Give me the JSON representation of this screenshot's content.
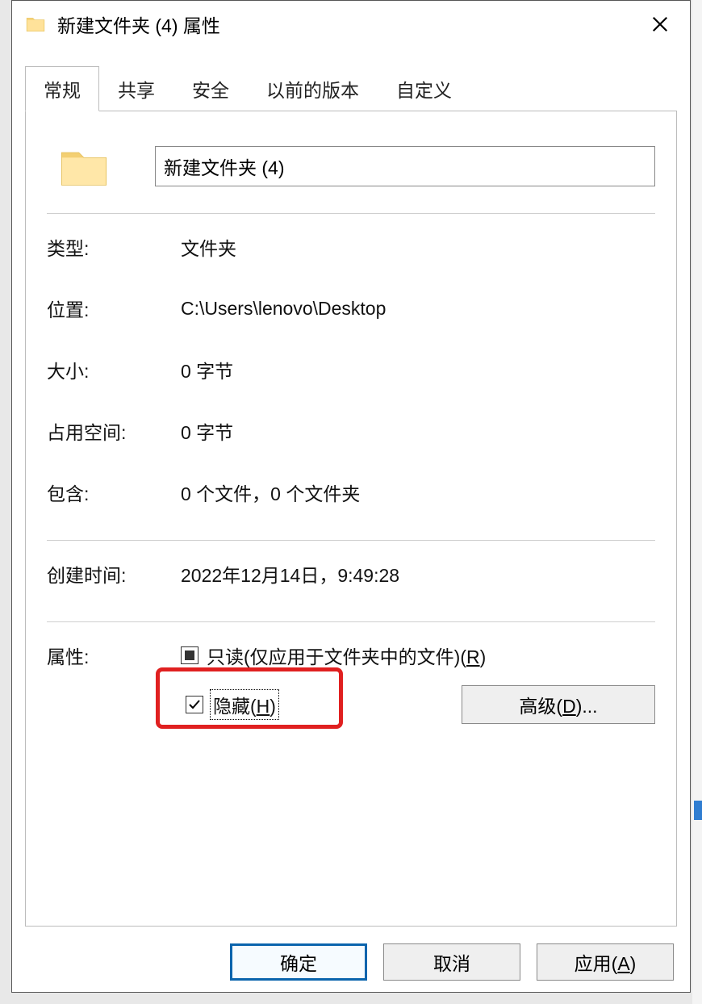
{
  "window": {
    "title": "新建文件夹 (4) 属性"
  },
  "tabs": [
    {
      "label": "常规",
      "active": true
    },
    {
      "label": "共享",
      "active": false
    },
    {
      "label": "安全",
      "active": false
    },
    {
      "label": "以前的版本",
      "active": false
    },
    {
      "label": "自定义",
      "active": false
    }
  ],
  "general": {
    "name_value": "新建文件夹 (4)",
    "type_label": "类型:",
    "type_value": "文件夹",
    "location_label": "位置:",
    "location_value": "C:\\Users\\lenovo\\Desktop",
    "size_label": "大小:",
    "size_value": "0 字节",
    "size_on_disk_label": "占用空间:",
    "size_on_disk_value": "0 字节",
    "contains_label": "包含:",
    "contains_value": "0 个文件，0 个文件夹",
    "created_label": "创建时间:",
    "created_value": "2022年12月14日，9:49:28",
    "attributes_label": "属性:",
    "readonly_label_prefix": "只读(仅应用于文件夹中的文件)(",
    "readonly_hotkey": "R",
    "readonly_label_suffix": ")",
    "readonly_state": "indeterminate",
    "hidden_label_prefix": "隐藏(",
    "hidden_hotkey": "H",
    "hidden_label_suffix": ")",
    "hidden_state": "checked",
    "advanced_label_prefix": "高级(",
    "advanced_hotkey": "D",
    "advanced_label_suffix": ")..."
  },
  "buttons": {
    "ok": "确定",
    "cancel": "取消",
    "apply_prefix": "应用(",
    "apply_hotkey": "A",
    "apply_suffix": ")"
  }
}
